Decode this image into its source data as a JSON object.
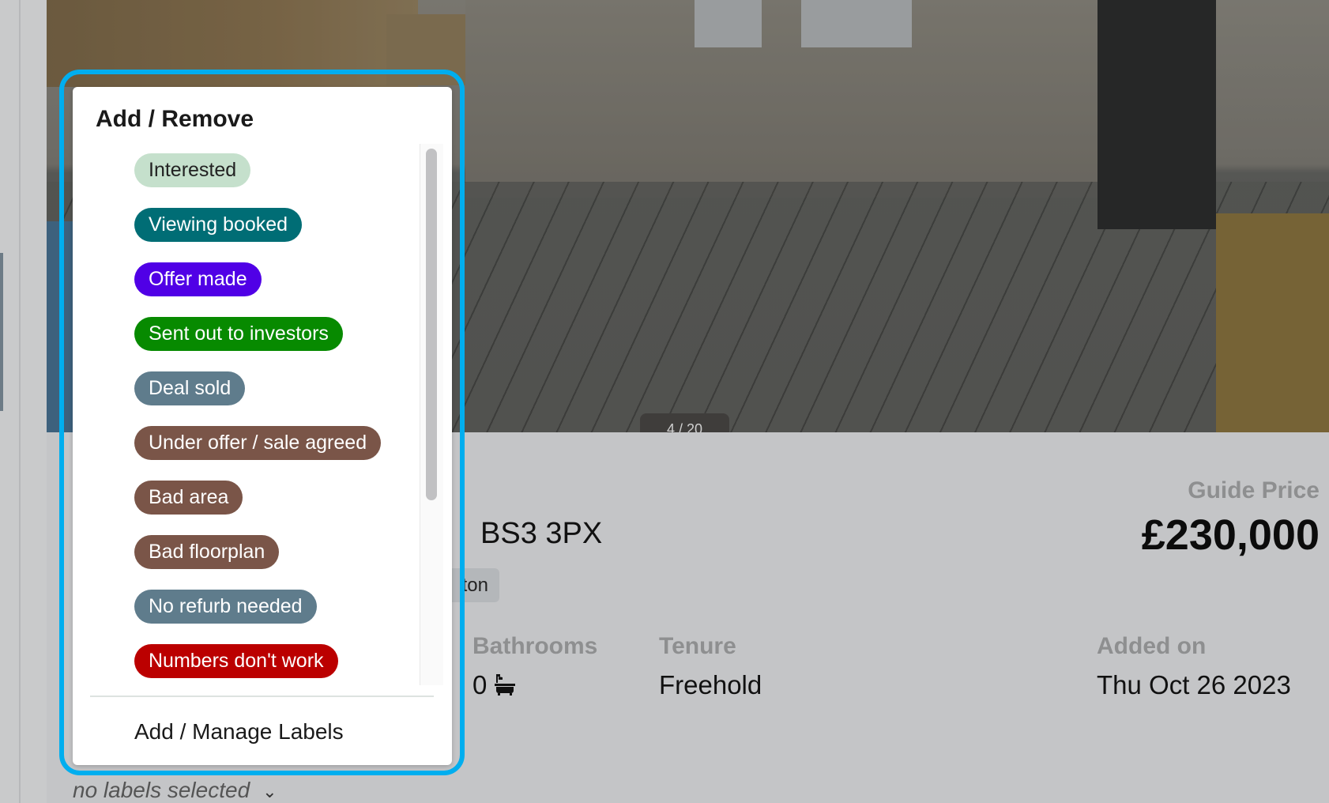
{
  "gallery": {
    "counter": "4 / 20"
  },
  "listing": {
    "address_visible": "BS3 3PX",
    "tag_visible": "ton",
    "guide_price_label": "Guide Price",
    "guide_price": "£230,000",
    "bathrooms_label": "Bathrooms",
    "bathrooms_value": "0",
    "tenure_label": "Tenure",
    "tenure_value": "Freehold",
    "added_label": "Added on",
    "added_value": "Thu Oct 26 2023"
  },
  "labels_dropdown": {
    "title": "Add / Remove",
    "items": [
      {
        "label": "Interested",
        "color": "#c5e0cc",
        "text_color": "#222222"
      },
      {
        "label": "Viewing booked",
        "color": "#006d75",
        "text_color": "#ffffff"
      },
      {
        "label": "Offer made",
        "color": "#5000e6",
        "text_color": "#ffffff"
      },
      {
        "label": "Sent out to investors",
        "color": "#078a00",
        "text_color": "#ffffff"
      },
      {
        "label": "Deal sold",
        "color": "#5f7c8c",
        "text_color": "#ffffff"
      },
      {
        "label": "Under offer / sale agreed",
        "color": "#7a5548",
        "text_color": "#ffffff"
      },
      {
        "label": "Bad area",
        "color": "#7a5548",
        "text_color": "#ffffff"
      },
      {
        "label": "Bad floorplan",
        "color": "#7a5548",
        "text_color": "#ffffff"
      },
      {
        "label": "No refurb needed",
        "color": "#5f7c8c",
        "text_color": "#ffffff"
      },
      {
        "label": "Numbers don't work",
        "color": "#bb0000",
        "text_color": "#ffffff"
      }
    ],
    "manage_label": "Add / Manage Labels",
    "scroll_position_fraction": 0,
    "highlight_color": "#00aeef"
  },
  "labels_selector": {
    "value": "no labels selected",
    "icon": "chevron-down-icon"
  }
}
